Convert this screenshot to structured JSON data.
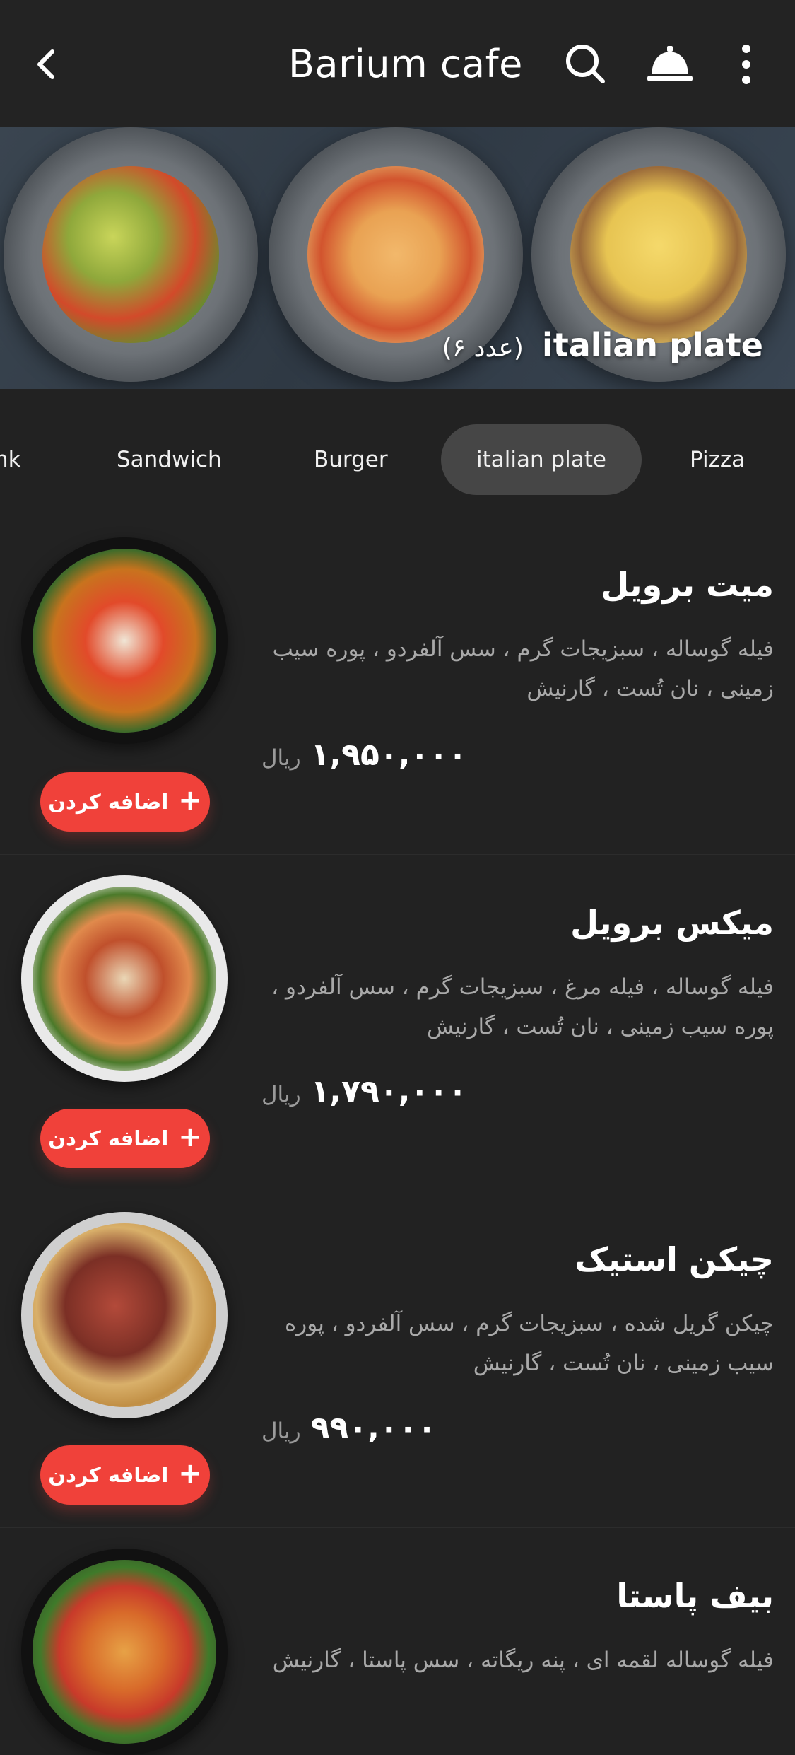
{
  "header": {
    "title": "Barium cafe",
    "icons": [
      "back-icon",
      "search-icon",
      "service-bell-icon",
      "more-vert-icon"
    ]
  },
  "banner": {
    "label": "italian plate",
    "count": "(۶ عدد)"
  },
  "tabs": [
    {
      "label": "nk"
    },
    {
      "label": "Sandwich"
    },
    {
      "label": "Burger"
    },
    {
      "label": "italian plate",
      "active": true
    },
    {
      "label": "Pizza"
    }
  ],
  "items": [
    {
      "name": "میت برویل",
      "description": "فیله گوساله ، سبزیجات گرم ، سس آلفردو ، پوره سیب زمینی ، نان تُست ، گارنیش",
      "price": "۱,۹۵۰,۰۰۰",
      "currency": "ریال",
      "add_label": "اضافه کردن"
    },
    {
      "name": "میکس برویل",
      "description": "فیله گوساله ، فیله مرغ ، سبزیجات گرم ، سس آلفردو ، پوره سیب زمینی ، نان تُست ، گارنیش",
      "price": "۱,۷۹۰,۰۰۰",
      "currency": "ریال",
      "add_label": "اضافه کردن"
    },
    {
      "name": "چیکن استیک",
      "description": "چیکن گریل شده ، سبزیجات گرم ، سس آلفردو ، پوره سیب زمینی ، نان تُست ، گارنیش",
      "price": "۹۹۰,۰۰۰",
      "currency": "ریال",
      "add_label": "اضافه کردن"
    },
    {
      "name": "بیف پاستا",
      "description": "فیله گوساله لقمه ای ، پنه ریگاته ، سس پاستا ، گارنیش"
    }
  ],
  "colors": {
    "background": "#222222",
    "accent": "#f0413a",
    "active_tab": "#464646",
    "muted_text": "#a9a9a9"
  }
}
